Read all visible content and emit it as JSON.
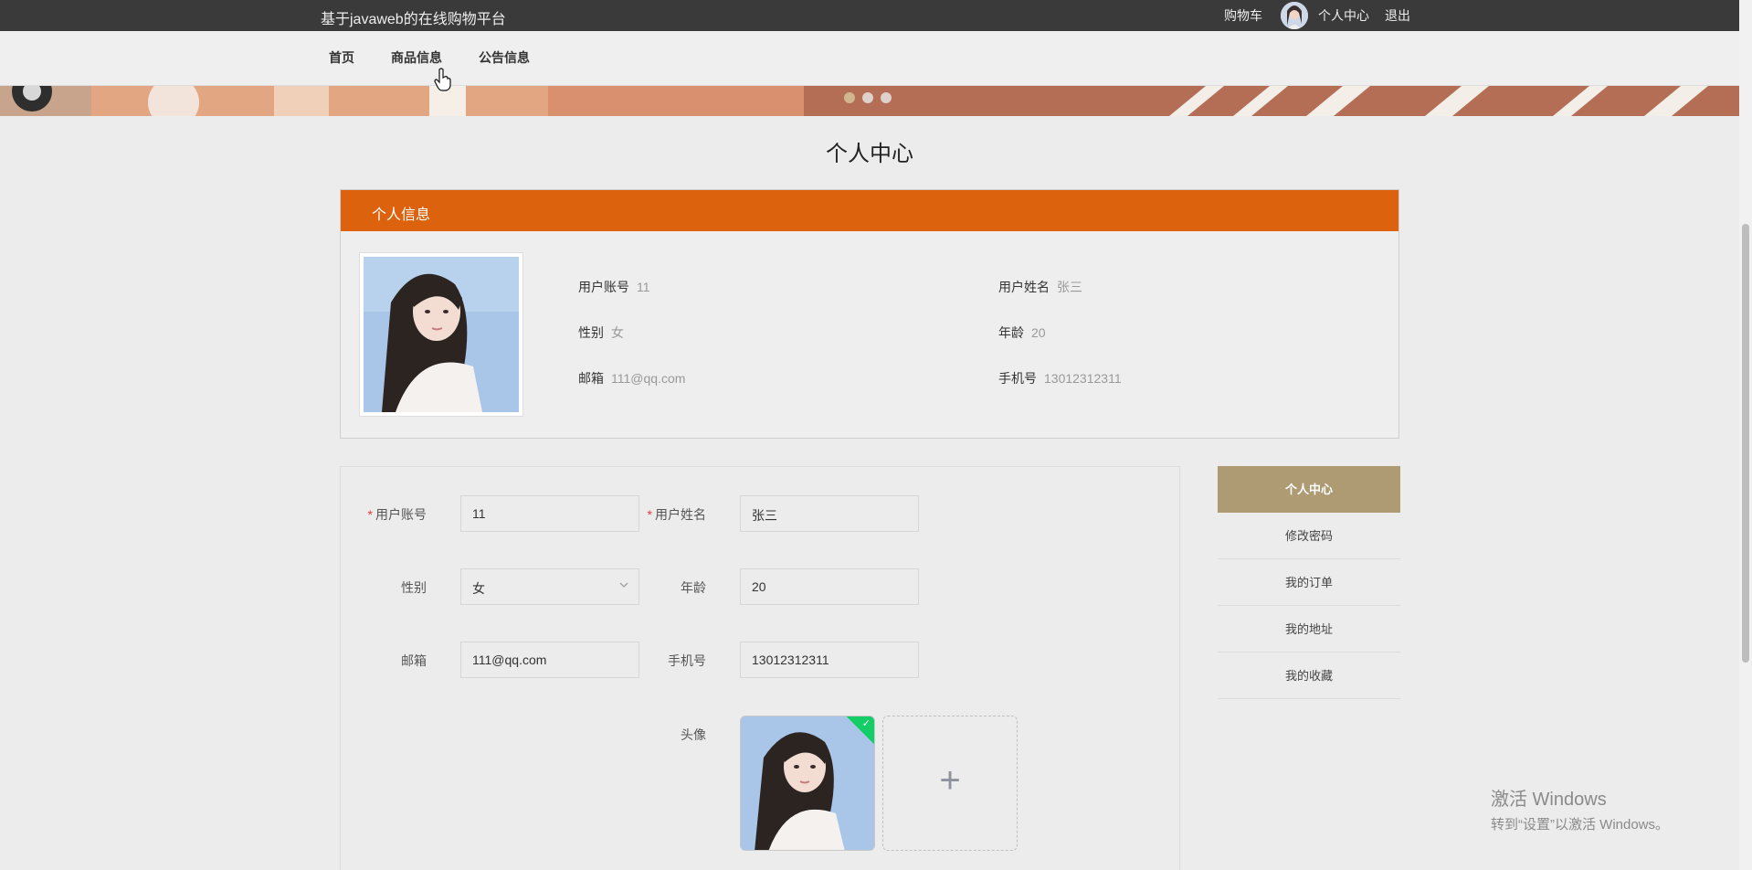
{
  "topbar": {
    "title": "基于javaweb的在线购物平台",
    "cart": "购物车",
    "user_center": "个人中心",
    "logout": "退出"
  },
  "nav": {
    "items": [
      {
        "label": "首页"
      },
      {
        "label": "商品信息"
      },
      {
        "label": "公告信息"
      }
    ]
  },
  "page": {
    "title": "个人中心"
  },
  "profile": {
    "header": "个人信息",
    "username_label": "用户账号",
    "username": "11",
    "name_label": "用户姓名",
    "name": "张三",
    "gender_label": "性别",
    "gender": "女",
    "age_label": "年龄",
    "age": "20",
    "email_label": "邮箱",
    "email": "111@qq.com",
    "phone_label": "手机号",
    "phone": "13012312311"
  },
  "form": {
    "required_mark": "*",
    "username_label": "用户账号",
    "username_value": "11",
    "name_label": "用户姓名",
    "name_value": "张三",
    "gender_label": "性别",
    "gender_value": "女",
    "age_label": "年龄",
    "age_value": "20",
    "email_label": "邮箱",
    "email_value": "111@qq.com",
    "phone_label": "手机号",
    "phone_value": "13012312311",
    "avatar_label": "头像",
    "add_symbol": "+"
  },
  "side_menu": {
    "items": [
      {
        "label": "个人中心",
        "active": true
      },
      {
        "label": "修改密码"
      },
      {
        "label": "我的订单"
      },
      {
        "label": "我的地址"
      },
      {
        "label": "我的收藏"
      }
    ]
  },
  "watermark": {
    "line1": "激活 Windows",
    "line2": "转到“设置”以激活 Windows。"
  },
  "colors": {
    "topbar_bg": "#3a3a3a",
    "profile_header_bg": "#dd620e",
    "side_active_bg": "#ae9b74",
    "upload_success": "#13ce66"
  }
}
